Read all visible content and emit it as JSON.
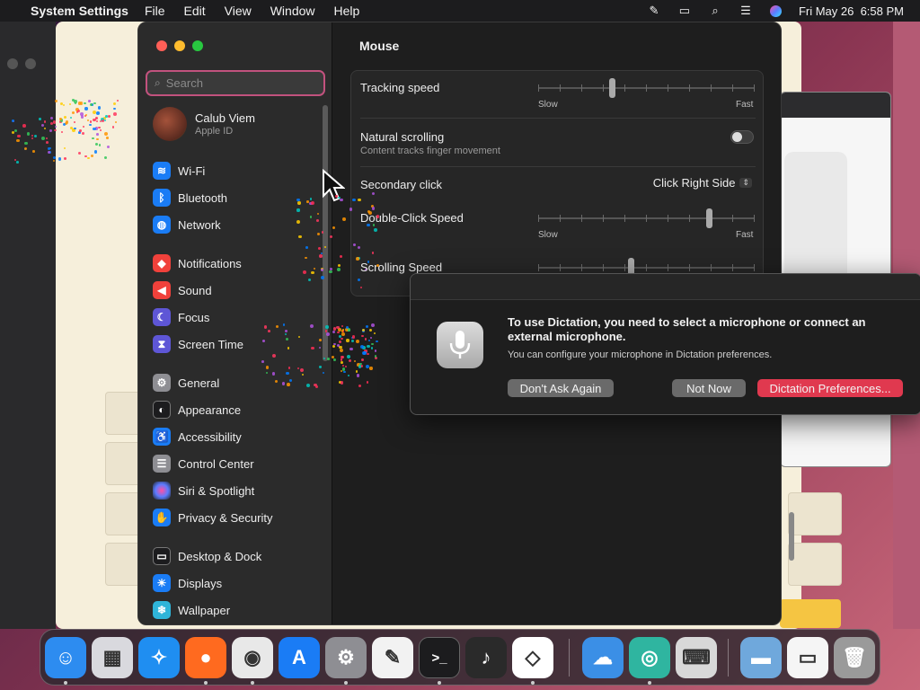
{
  "menubar": {
    "app_name": "System Settings",
    "menus": [
      "File",
      "Edit",
      "View",
      "Window",
      "Help"
    ],
    "datetime": "Fri May 26  6:58 PM",
    "status_icons": [
      "pen-icon",
      "screen-mirror-icon",
      "spotlight-search-icon",
      "control-center-icon",
      "siri-icon"
    ]
  },
  "sidebar": {
    "search_placeholder": "Search",
    "user": {
      "name": "Calub Viem",
      "subtitle": "Apple ID"
    },
    "items": [
      {
        "label": "Wi-Fi",
        "icon": "wifi-icon",
        "color": "#1a7cf5"
      },
      {
        "label": "Bluetooth",
        "icon": "bluetooth-icon",
        "color": "#1a7cf5"
      },
      {
        "label": "Network",
        "icon": "globe-icon",
        "color": "#1a7cf5"
      },
      {
        "label": "Notifications",
        "icon": "bell-icon",
        "color": "#f0413b"
      },
      {
        "label": "Sound",
        "icon": "speaker-icon",
        "color": "#f0413b"
      },
      {
        "label": "Focus",
        "icon": "moon-icon",
        "color": "#5e56d6"
      },
      {
        "label": "Screen Time",
        "icon": "hourglass-icon",
        "color": "#5e56d6"
      },
      {
        "label": "General",
        "icon": "gear-icon",
        "color": "#8e8e93"
      },
      {
        "label": "Appearance",
        "icon": "appearance-icon",
        "color": "#1c1c1e"
      },
      {
        "label": "Accessibility",
        "icon": "accessibility-icon",
        "color": "#1a7cf5"
      },
      {
        "label": "Control Center",
        "icon": "control-center-icon",
        "color": "#8e8e93"
      },
      {
        "label": "Siri & Spotlight",
        "icon": "siri-icon",
        "color": "#9b4ad6"
      },
      {
        "label": "Privacy & Security",
        "icon": "hand-icon",
        "color": "#1a7cf5"
      },
      {
        "label": "Desktop & Dock",
        "icon": "dock-icon",
        "color": "#1c1c1e"
      },
      {
        "label": "Displays",
        "icon": "sun-icon",
        "color": "#1a7cf5"
      },
      {
        "label": "Wallpaper",
        "icon": "snowflake-icon",
        "color": "#2fb5d9"
      }
    ]
  },
  "main": {
    "title": "Mouse",
    "tracking_speed": {
      "label": "Tracking speed",
      "min_label": "Slow",
      "max_label": "Fast",
      "value": 0.34
    },
    "natural_scrolling": {
      "label": "Natural scrolling",
      "description": "Content tracks finger movement",
      "on": false
    },
    "secondary_click": {
      "label": "Secondary click",
      "value": "Click Right Side"
    },
    "double_click_speed": {
      "label": "Double-Click Speed",
      "min_label": "Slow",
      "max_label": "Fast",
      "value": 0.79
    },
    "scrolling_speed": {
      "label": "Scrolling Speed",
      "value": 0.43
    }
  },
  "dialog": {
    "title": "To use Dictation, you need to select a microphone or connect an external microphone.",
    "body": "You can configure your microphone in Dictation preferences.",
    "buttons": {
      "dont_ask": "Don't Ask Again",
      "not_now": "Not Now",
      "prefs": "Dictation Preferences..."
    },
    "icon": "microphone-icon",
    "accent": "#e0394f"
  },
  "dock": {
    "apps": [
      {
        "name": "finder-icon",
        "color": "#2d8cf0",
        "running": true
      },
      {
        "name": "launchpad-icon",
        "color": "#d9d9de",
        "running": false
      },
      {
        "name": "safari-icon",
        "color": "#1f8ef1",
        "running": false
      },
      {
        "name": "firefox-icon",
        "color": "#ff6a1f",
        "running": true
      },
      {
        "name": "chrome-icon",
        "color": "#e8e8e8",
        "running": true
      },
      {
        "name": "app-store-icon",
        "color": "#1a7cf5",
        "running": false
      },
      {
        "name": "system-settings-icon",
        "color": "#8e8e93",
        "running": true
      },
      {
        "name": "textedit-icon",
        "color": "#f2f2f2",
        "running": false
      },
      {
        "name": "terminal-icon",
        "color": "#1c1c1e",
        "running": true
      },
      {
        "name": "garageband-icon",
        "color": "#2a2a2a",
        "running": false
      },
      {
        "name": "vscode-icon",
        "color": "#ffffff",
        "running": true
      },
      {
        "name": "weather-icon",
        "color": "#3b8fe6",
        "running": false
      },
      {
        "name": "app-icon",
        "color": "#2fb5a0",
        "running": true
      },
      {
        "name": "keyboard-input-icon",
        "color": "#d8d8d8",
        "running": false
      },
      {
        "name": "folder-icon",
        "color": "#6fa8dc",
        "running": false
      },
      {
        "name": "window-icon",
        "color": "#f5f5f5",
        "running": false
      },
      {
        "name": "trash-icon",
        "color": "#9a9a9a",
        "running": false
      }
    ]
  }
}
